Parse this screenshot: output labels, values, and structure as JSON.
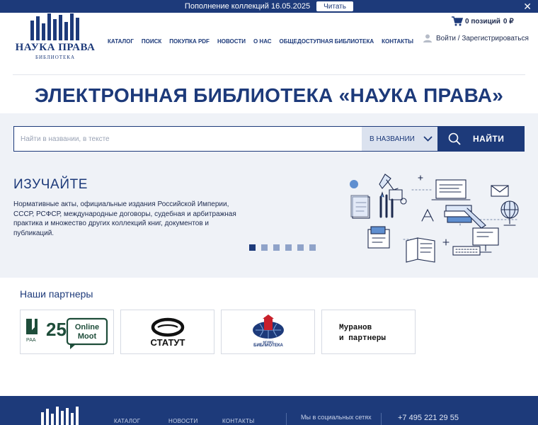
{
  "announcement": {
    "text": "Пополнение коллекций 16.05.2025",
    "button_label": "Читать",
    "close_glyph": "✕"
  },
  "logo": {
    "title": "НАУКА ПРАВА",
    "subtitle": "БИБЛИОТЕКА"
  },
  "nav": {
    "items": [
      "КАТАЛОГ",
      "ПОИСК",
      "ПОКУПКА PDF",
      "НОВОСТИ",
      "О НАС",
      "ОБЩЕДОСТУПНАЯ БИБЛИОТЕКА",
      "КОНТАКТЫ"
    ]
  },
  "cart": {
    "label": "0 позиций",
    "total": "0 ₽"
  },
  "account": {
    "label": "Войти / Зарегистрироваться"
  },
  "page_title": "ЭЛЕКТРОННАЯ БИБЛИОТЕКА «НАУКА ПРАВА»",
  "search": {
    "placeholder": "Найти в названии, в тексте",
    "scope": "В НАЗВАНИИ",
    "button_label": "НАЙТИ"
  },
  "slider": {
    "heading": "ИЗУЧАЙТЕ",
    "text": "Нормативные акты, официальные издания Российской Империи, СССР, РСФСР, международные договоры, судебная и арбитражная практика и множество других коллекций книг, документов и публикаций.",
    "slide_count": 6,
    "active_slide": 1
  },
  "partners": {
    "heading": "Наши партнеры",
    "items": [
      {
        "name": "РАА 25 Online Moot",
        "logo_text": [
          "РАА",
          "25",
          "Online",
          "Moot"
        ]
      },
      {
        "name": "Статут",
        "logo_text": [
          "СТАТУТ"
        ]
      },
      {
        "name": "МГИМО Библиотека",
        "logo_text": [
          "МГИМО",
          "БИБЛИОТЕКА"
        ]
      },
      {
        "name": "Муранов и партнеры",
        "logo_text": [
          "Муранов",
          "и партнеры"
        ]
      }
    ]
  },
  "footer": {
    "links": [
      "КАТАЛОГ",
      "НОВОСТИ",
      "КОНТАКТЫ"
    ],
    "social_label": "Мы в социальных сетях",
    "phone": "+7 495 221 29 55"
  },
  "colors": {
    "brand": "#1d3a7a",
    "hero_bg": "#eff2f7",
    "dot_inactive": "#8fa3c9"
  }
}
